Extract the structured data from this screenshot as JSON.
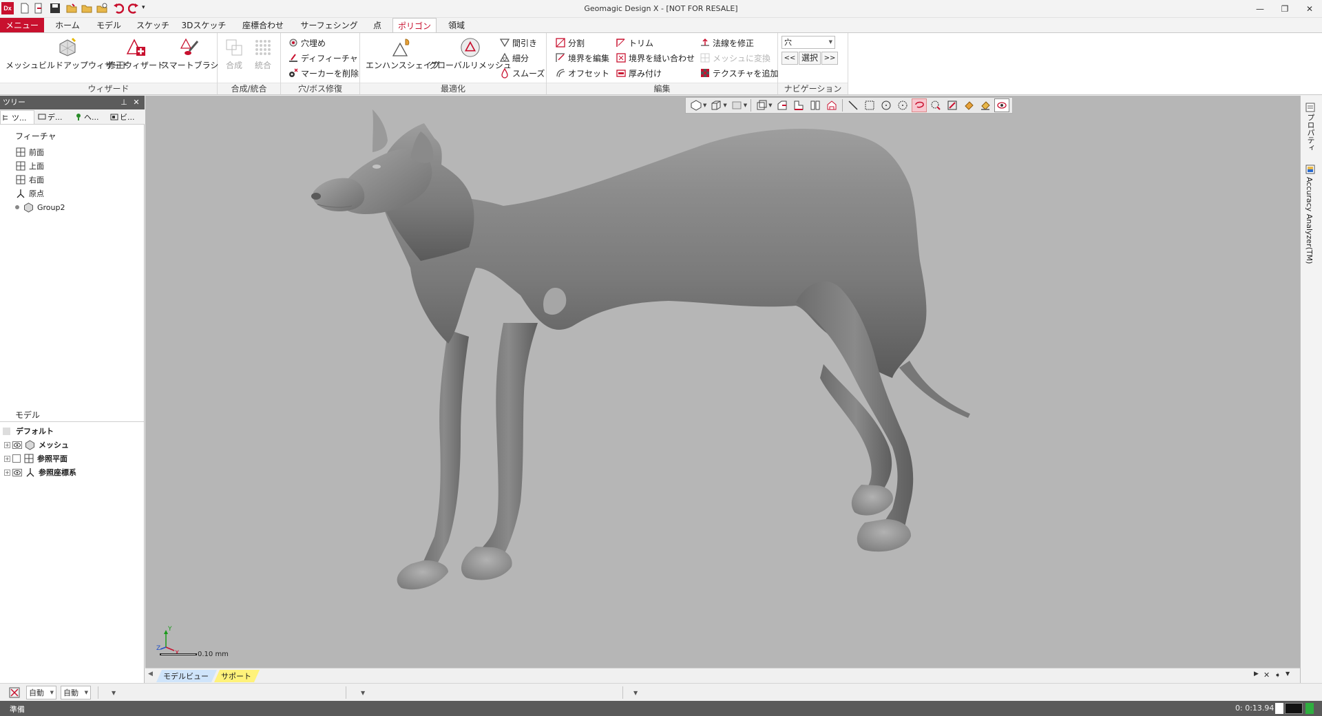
{
  "titlebar": {
    "logo": "Dx",
    "title": "Geomagic Design X - [NOT FOR RESALE]",
    "quick_access_icons": [
      "new-file-icon",
      "open-icon",
      "save-icon",
      "open-folder-icon",
      "folder-icon",
      "open-recent-icon",
      "undo-icon",
      "redo-icon",
      "customize-icon"
    ],
    "window_buttons": [
      "minimize",
      "restore",
      "close"
    ]
  },
  "menu_tabs": [
    {
      "label": "メニュー",
      "kind": "app"
    },
    {
      "label": "ホーム"
    },
    {
      "label": "モデル"
    },
    {
      "label": "スケッチ"
    },
    {
      "label": "3Dスケッチ"
    },
    {
      "label": "座標合わせ"
    },
    {
      "label": "サーフェシング"
    },
    {
      "label": "点"
    },
    {
      "label": "ポリゴン",
      "active": true
    },
    {
      "label": "領域"
    }
  ],
  "ribbon": {
    "groups": [
      {
        "label": "ウィザード"
      },
      {
        "label": "合成/統合"
      },
      {
        "label": "穴/ボス修復"
      },
      {
        "label": "最適化"
      },
      {
        "label": "編集"
      },
      {
        "label": "ナビゲーション"
      }
    ],
    "wizard": {
      "mesh_buildup": "メッシュビルドアップウィザード",
      "repair": "修正ウィザード",
      "smart_brush": "スマートブラシ"
    },
    "merge": {
      "combine": "合成",
      "integrate": "統合"
    },
    "holes": {
      "fill_holes": "穴埋め",
      "defeature": "ディフィーチャ",
      "remove_markers": "マーカーを削除"
    },
    "optimize": {
      "enhance_shape": "エンハンスシェイプ",
      "global_remesh": "グローバルリメッシュ",
      "decimate": "間引き",
      "subdivide": "細分",
      "smooth": "スムーズ"
    },
    "edit": {
      "split": "分割",
      "edit_boundaries": "境界を編集",
      "offset": "オフセット",
      "trim": "トリム",
      "stitch_boundaries": "境界を縫い合わせ",
      "thicken": "厚み付け",
      "fix_normals": "法線を修正",
      "convert_to_mesh": "メッシュに変換",
      "add_texture": "テクスチャを追加"
    },
    "navigation": {
      "select_value": "穴",
      "prev": "<<",
      "select": "選択",
      "next": ">>"
    }
  },
  "left_panel": {
    "title": "ツリー",
    "tabs": [
      "ツ...",
      "デ...",
      "ヘ...",
      "ビ..."
    ],
    "feature_section": "フィーチャ",
    "features": [
      {
        "label": "前面",
        "icon": "plane-icon"
      },
      {
        "label": "上面",
        "icon": "plane-icon"
      },
      {
        "label": "右面",
        "icon": "plane-icon"
      },
      {
        "label": "原点",
        "icon": "origin-icon"
      },
      {
        "label": "Group2",
        "icon": "mesh-icon"
      }
    ],
    "model_section": "モデル",
    "default_label": "デフォルト",
    "model_items": [
      {
        "label": "メッシュ",
        "icon": "mesh-icon"
      },
      {
        "label": "参照平面",
        "icon": "plane-icon"
      },
      {
        "label": "参照座標系",
        "icon": "origin-icon"
      }
    ]
  },
  "viewport": {
    "background": "#b6b6b6",
    "model": "dog-mesh",
    "scale_label": "0.10 mm",
    "axis_labels": {
      "x": "X",
      "y": "Y",
      "z": "Z"
    },
    "toolbar_icons": [
      "view-mode-icon",
      "cube-view-icon",
      "render-mode-icon",
      "section-icon",
      "front-view-icon",
      "top-view-icon",
      "split-view-icon",
      "flip-icon",
      "line-select-icon",
      "rect-select-icon",
      "circle-select-icon",
      "poly-select-icon",
      "lasso-select-icon",
      "brush-select-icon",
      "paint-select-icon",
      "fill-select-icon",
      "bucket-icon",
      "visible-only-icon"
    ]
  },
  "right_panel": {
    "tabs": [
      "プロパティ",
      "Accuracy Analyzer(TM)"
    ]
  },
  "bottom_tabs": {
    "model_view": "モデルビュー",
    "support": "サポート"
  },
  "secondary_toolbar": {
    "auto1": "自動",
    "auto2": "自動"
  },
  "statusbar": {
    "text": "準備",
    "time": "0: 0:13.94"
  },
  "colors": {
    "accent": "#c8102e",
    "viewport": "#b6b6b6",
    "status": "#5a5a5a"
  }
}
